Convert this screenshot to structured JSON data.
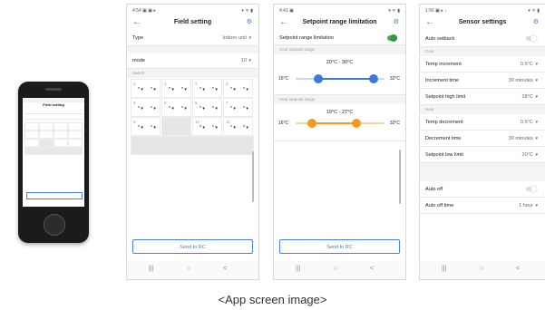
{
  "caption": "<App screen image>",
  "mini_phone": {
    "title": "Field setting",
    "type_label": "Type",
    "mode_label": "mode",
    "send_label": "Send to RC"
  },
  "field_setting": {
    "status_left": "4:54 ▣ ▣ ▸",
    "status_right": "▾ ᯤ ▮",
    "title": "Field setting",
    "type_label": "Type",
    "type_value": "Indoor unit",
    "mode_label": "mode",
    "mode_value": "10",
    "switch_label": "Switch",
    "cells": [
      {
        "n": "0"
      },
      {
        "n": "1"
      },
      {
        "n": "2"
      },
      {
        "n": "3"
      },
      {
        "n": "4"
      },
      {
        "n": "5"
      },
      {
        "n": "6"
      },
      {
        "n": "7"
      },
      {
        "n": "8"
      },
      {
        "n": ""
      },
      {
        "n": "10"
      },
      {
        "n": "11"
      }
    ],
    "cell_a": "*",
    "cell_b": "*",
    "send_label": "Send to RC",
    "nav": [
      "|||",
      "○",
      "<"
    ]
  },
  "setpoint_range": {
    "status_left": "4:41 ▣",
    "status_right": "▾ ᯤ ▮",
    "title": "Setpoint range limitation",
    "toggle_label": "Setpoint range limitation",
    "toggle_on": true,
    "cool_section": "Cool setpoint range",
    "cool_range": "20°C - 30°C",
    "cool_min": "16°C",
    "cool_max": "32°C",
    "cool_low": 20,
    "cool_high": 30,
    "heat_section": "Heat setpoint range",
    "heat_range": "19°C - 27°C",
    "heat_min": "16°C",
    "heat_max": "32°C",
    "heat_low": 19,
    "heat_high": 27,
    "scale_min": 16,
    "scale_max": 32,
    "cool_color": "#3b7bd8",
    "heat_color": "#f39a1e",
    "send_label": "Send to RC",
    "nav": [
      "|||",
      "○",
      "<"
    ]
  },
  "sensor_settings": {
    "status_left": "1:56 ▣ ▸ ↓",
    "status_right": "▾ ᯤ ▮",
    "title": "Sensor settings",
    "auto_setback": "Auto setback",
    "cool_section": "Cool",
    "temp_increment": "Temp increment",
    "temp_increment_val": "0.5°C",
    "increment_time": "Increment time",
    "increment_time_val": "30 minutes",
    "setpoint_high": "Setpoint high limit",
    "setpoint_high_val": "28°C",
    "heat_section": "Heat",
    "temp_decrement": "Temp decrement",
    "temp_decrement_val": "0.5°C",
    "decrement_time": "Decrement time",
    "decrement_time_val": "30 minutes",
    "setpoint_low": "Setpoint low limit",
    "setpoint_low_val": "20°C",
    "auto_off": "Auto off",
    "auto_off_time": "Auto off time",
    "auto_off_time_val": "1 hour",
    "nav": [
      "|||",
      "○",
      "<"
    ]
  }
}
